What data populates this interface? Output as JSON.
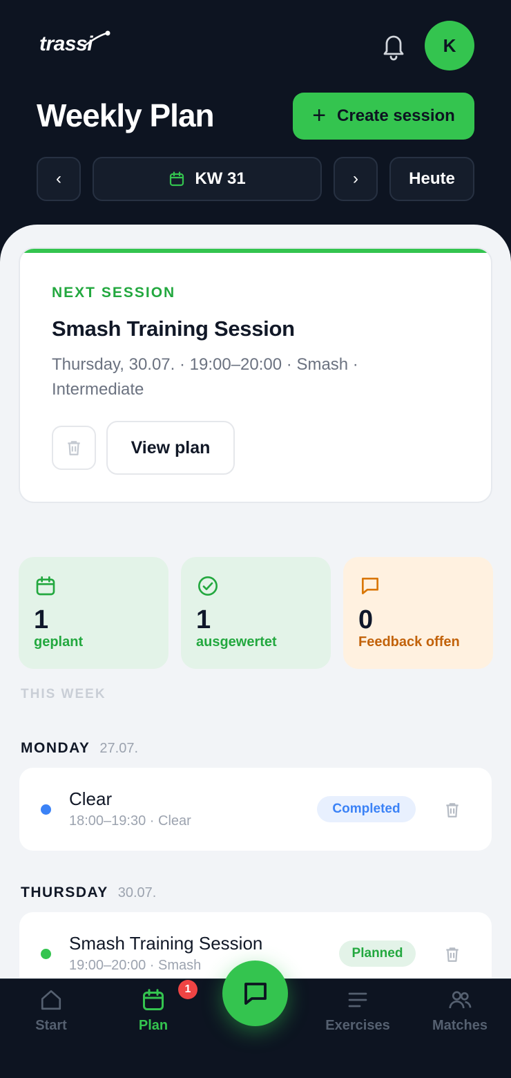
{
  "app": {
    "logo_text": "trassi",
    "avatar_initial": "K"
  },
  "header": {
    "title": "Weekly Plan",
    "create_label": "Create session",
    "week_label": "KW 31",
    "prev_label": "‹",
    "next_label": "›",
    "today_label": "Heute"
  },
  "next_session": {
    "label": "NEXT SESSION",
    "title": "Smash Training Session",
    "meta": "Thursday, 30.07. · 19:00–20:00 · Smash · Intermediate",
    "view_label": "View plan"
  },
  "stats": [
    {
      "value": "1",
      "label": "geplant",
      "color": "#23a83f"
    },
    {
      "value": "1",
      "label": "ausgewertet",
      "color": "#23a83f"
    },
    {
      "value": "0",
      "label": "Feedback offen",
      "color": "#c2620a"
    }
  ],
  "section_label": "THIS WEEK",
  "days": [
    {
      "name": "MONDAY",
      "date": "27.07.",
      "session": {
        "title": "Clear",
        "meta": "18:00–19:30 · Clear",
        "status": "Completed",
        "dot_color": "#3b82f6"
      }
    },
    {
      "name": "THURSDAY",
      "date": "30.07.",
      "session": {
        "title": "Smash Training Session",
        "meta": "19:00–20:00 · Smash",
        "status": "Planned",
        "dot_color": "#34c44f"
      }
    }
  ],
  "bottom_nav": {
    "items": [
      {
        "label": "Start",
        "icon": "home-icon"
      },
      {
        "label": "Plan",
        "icon": "calendar-icon",
        "badge": "1"
      },
      {
        "label": "Exercises",
        "icon": "list-icon"
      },
      {
        "label": "Matches",
        "icon": "users-icon"
      }
    ],
    "fab_icon": "chat-icon"
  },
  "colors": {
    "accent": "#34c44f",
    "dark": "#0d1421",
    "content_bg": "#f2f4f7"
  }
}
